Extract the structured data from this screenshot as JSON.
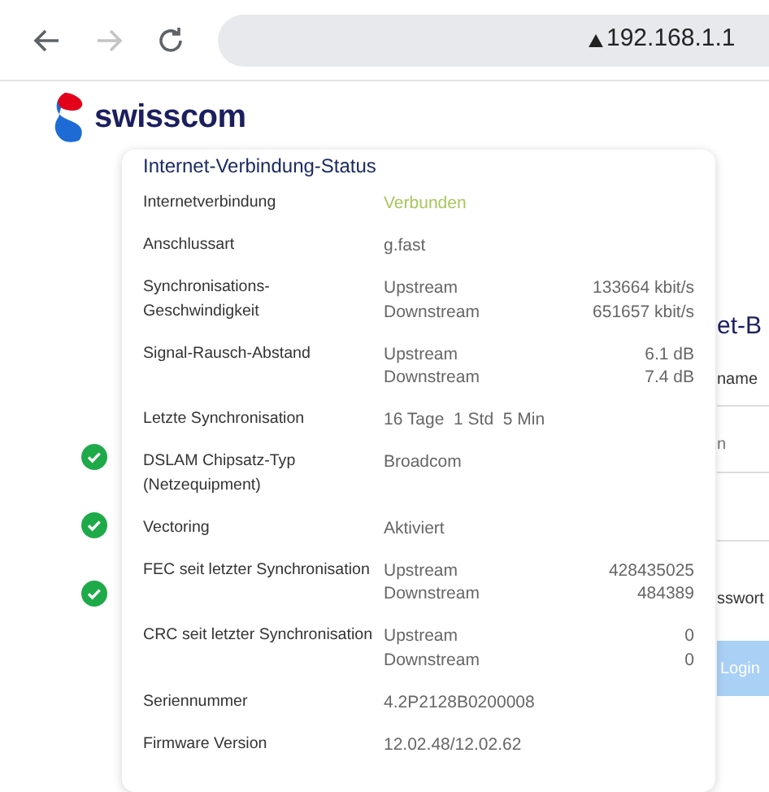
{
  "browser": {
    "nav_buttons": [
      {
        "kind": "back",
        "disabled": false
      },
      {
        "kind": "forward",
        "disabled": true
      },
      {
        "kind": "reload",
        "disabled": false
      }
    ],
    "url": "192.168.1.1"
  },
  "logo": {
    "text": "swisscom"
  },
  "background_page": {
    "heading": "et-B",
    "name_label": "name",
    "name_field": {
      "placeholder": "n"
    },
    "password_label": "sswort",
    "login_button": "Login"
  },
  "status_panel": {
    "title": "Internet-Verbindung-Status",
    "rows": [
      {
        "kind": "status",
        "label": "Internetverbindung",
        "value": "Verbunden"
      },
      {
        "kind": "text",
        "label": "Anschlussart",
        "value": "g.fast"
      },
      {
        "kind": "pairs",
        "label": "Synchronisations-Geschwindigkeit",
        "pairs": [
          {
            "name": "Upstream",
            "value": "133664 kbit/s"
          },
          {
            "name": "Downstream",
            "value": "651657 kbit/s"
          }
        ]
      },
      {
        "kind": "pairs",
        "label": "Signal-Rausch-Abstand",
        "pairs": [
          {
            "name": "Upstream",
            "value": "6.1 dB"
          },
          {
            "name": "Downstream",
            "value": "7.4 dB"
          }
        ]
      },
      {
        "kind": "text",
        "label": "Letzte Synchronisation",
        "value": "16 Tage  1 Std  5 Min"
      },
      {
        "kind": "text",
        "label": "DSLAM Chipsatz-Typ (Netzequipment)",
        "value": "Broadcom"
      },
      {
        "kind": "text",
        "label": "Vectoring",
        "value": "Aktiviert"
      },
      {
        "kind": "pairs",
        "label": "FEC seit letzter Synchronisation",
        "pairs": [
          {
            "name": "Upstream",
            "value": "428435025"
          },
          {
            "name": "Downstream",
            "value": "484389"
          }
        ]
      },
      {
        "kind": "pairs",
        "label": "CRC seit letzter Synchronisation",
        "pairs": [
          {
            "name": "Upstream",
            "value": "0"
          },
          {
            "name": "Downstream",
            "value": "0"
          }
        ]
      },
      {
        "kind": "text",
        "label": "Seriennummer",
        "value": "4.2P2128B0200008"
      },
      {
        "kind": "text",
        "label": "Firmware Version",
        "value": "12.02.48/12.02.62"
      }
    ]
  }
}
